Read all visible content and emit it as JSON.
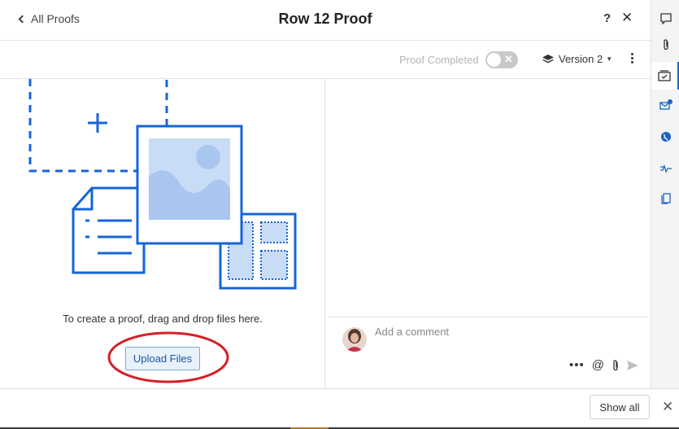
{
  "header": {
    "back_label": "All Proofs",
    "title": "Row 12 Proof",
    "help_label": "?",
    "close_label": "✕"
  },
  "toolbar": {
    "proof_completed_label": "Proof Completed",
    "proof_completed": false,
    "version_label": "Version 2"
  },
  "dropzone": {
    "instruction": "To create a proof, drag and drop files here.",
    "upload_button": "Upload Files"
  },
  "comments": {
    "placeholder": "Add a comment",
    "more_label": "•••",
    "mention_label": "@"
  },
  "bottom_bar": {
    "show_all_label": "Show all",
    "close_label": "✕"
  },
  "rail": {
    "items": [
      "comment-icon",
      "attachment-icon",
      "proof-icon",
      "email-icon",
      "globe-icon",
      "activity-icon",
      "documents-icon"
    ],
    "active_item": "proof-icon"
  },
  "colors": {
    "accent": "#1a63c6",
    "illustration_blue": "#1565d8",
    "illustration_fill": "#c9dcf5",
    "annotation_red": "#d42027"
  }
}
